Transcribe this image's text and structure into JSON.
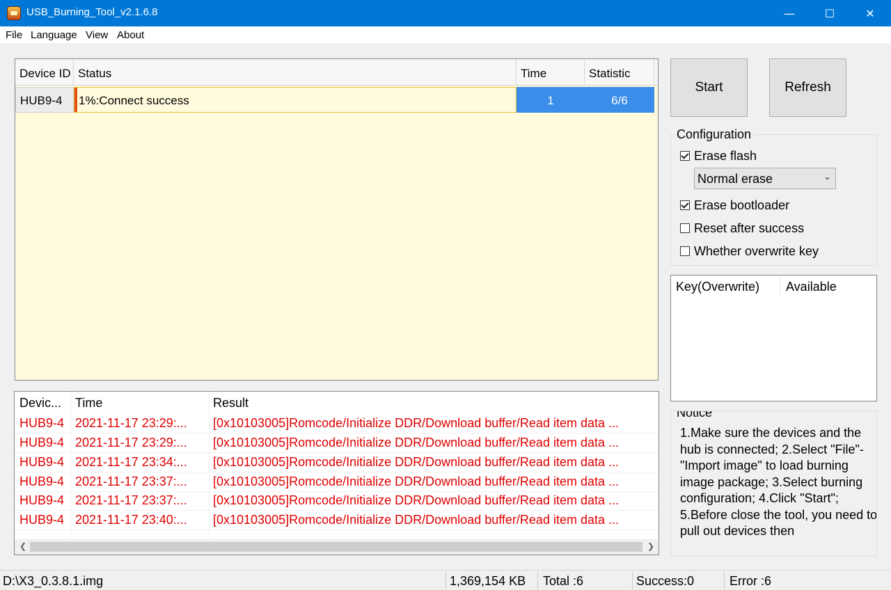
{
  "window": {
    "title": "USB_Burning_Tool_v2.1.6.8",
    "minimize": "—",
    "maximize": "☐",
    "close": "✕"
  },
  "menu": [
    "File",
    "Language",
    "View",
    "About"
  ],
  "device_table": {
    "headers": [
      "Device ID",
      "Status",
      "Time",
      "Statistic"
    ],
    "row": {
      "device_id": "HUB9-4",
      "status": "1%:Connect success",
      "progress": 1,
      "time": "1",
      "statistic": "6/6"
    }
  },
  "buttons": {
    "start": "Start",
    "refresh": "Refresh"
  },
  "configuration": {
    "label": "Configuration",
    "erase_flash": {
      "label": "Erase flash",
      "checked": true
    },
    "erase_mode": "Normal erase",
    "erase_bootloader": {
      "label": "Erase bootloader",
      "checked": true
    },
    "reset_after_success": {
      "label": "Reset after success",
      "checked": false
    },
    "overwrite_key": {
      "label": "Whether overwrite key",
      "checked": false
    }
  },
  "key_table": {
    "headers": [
      "Key(Overwrite)",
      "Available"
    ]
  },
  "notice": {
    "label": "Notice",
    "text": "1.Make sure the devices and the hub is connected; 2.Select \"File\"-\"Import image\" to load burning image package; 3.Select burning configuration; 4.Click \"Start\"; 5.Before close the tool, you need to pull out devices then"
  },
  "log_table": {
    "headers": [
      "Devic...",
      "Time",
      "Result"
    ],
    "rows": [
      {
        "device": "HUB9-4",
        "time": "2021-11-17 23:29:...",
        "result": "[0x10103005]Romcode/Initialize DDR/Download buffer/Read item data ..."
      },
      {
        "device": "HUB9-4",
        "time": "2021-11-17 23:29:...",
        "result": "[0x10103005]Romcode/Initialize DDR/Download buffer/Read item data ..."
      },
      {
        "device": "HUB9-4",
        "time": "2021-11-17 23:34:...",
        "result": "[0x10103005]Romcode/Initialize DDR/Download buffer/Read item data ..."
      },
      {
        "device": "HUB9-4",
        "time": "2021-11-17 23:37:...",
        "result": "[0x10103005]Romcode/Initialize DDR/Download buffer/Read item data ..."
      },
      {
        "device": "HUB9-4",
        "time": "2021-11-17 23:37:...",
        "result": "[0x10103005]Romcode/Initialize DDR/Download buffer/Read item data ..."
      },
      {
        "device": "HUB9-4",
        "time": "2021-11-17 23:40:...",
        "result": "[0x10103005]Romcode/Initialize DDR/Download buffer/Read item data ..."
      }
    ]
  },
  "statusbar": {
    "image_path": "D:\\X3_0.3.8.1.img",
    "size": "1,369,154 KB",
    "total": "Total :6",
    "success": "Success:0",
    "error": "Error :6"
  },
  "colors": {
    "title_bar": "#0078d7",
    "selection": "#3a8de8",
    "device_table_bg": "#fffbdc",
    "error_text": "#e00000"
  }
}
